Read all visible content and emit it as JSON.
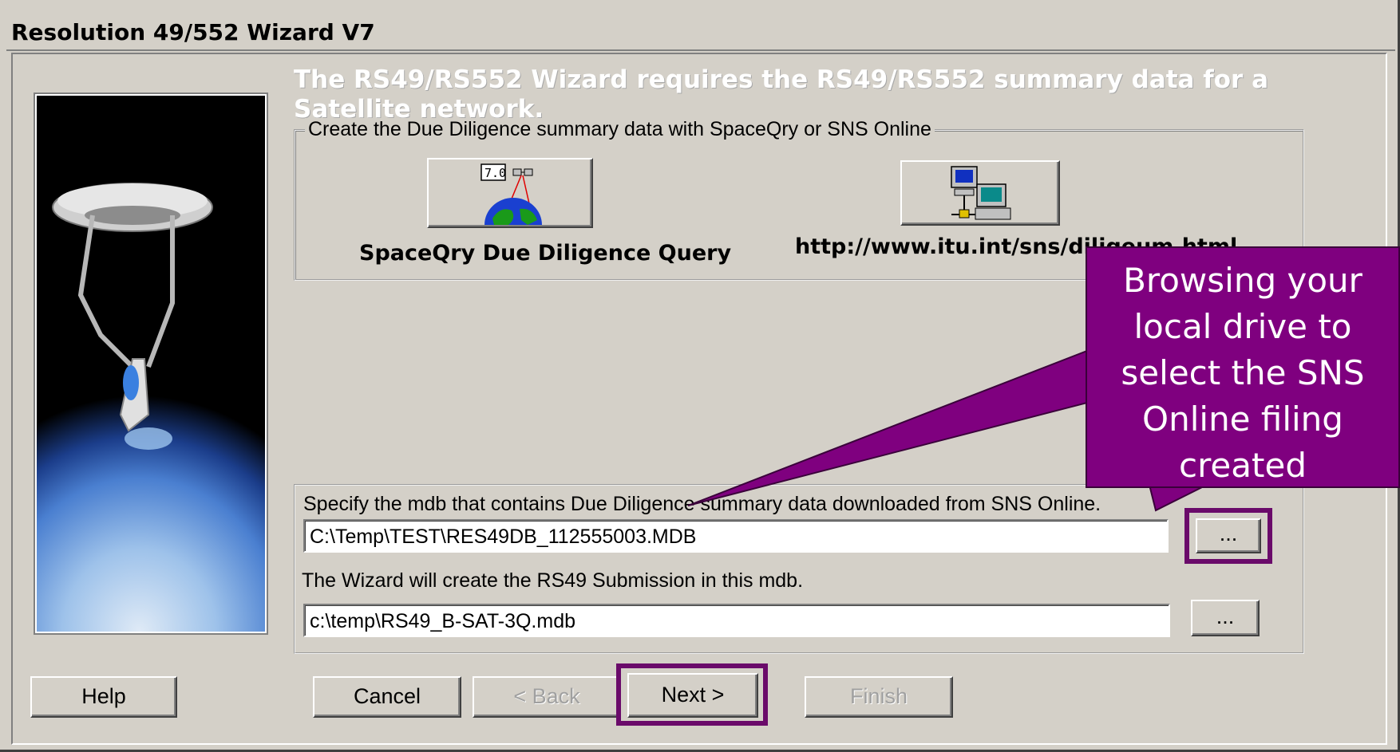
{
  "window": {
    "title": "Resolution 49/552 Wizard V7"
  },
  "intro_text": "The RS49/RS552 Wizard requires the RS49/RS552 summary data for a Satellite network.",
  "create_group": {
    "label": "Create the Due Diligence summary data with SpaceQry or SNS Online",
    "spaceqry_caption": "SpaceQry Due Diligence Query",
    "spaceqry_icon_badge": "7.0",
    "sns_caption": "http://www.itu.int/sns/diligeum.html"
  },
  "source_mdb": {
    "label": "Specify the mdb that contains  Due Diligence summary data downloaded from SNS Online.",
    "value": "C:\\Temp\\TEST\\RES49DB_112555003.MDB",
    "browse_label": "..."
  },
  "target_mdb": {
    "label": "The Wizard will create the  RS49 Submission in this mdb.",
    "value": "c:\\temp\\RS49_B-SAT-3Q.mdb",
    "browse_label": "..."
  },
  "buttons": {
    "help": "Help",
    "cancel": "Cancel",
    "back": "< Back",
    "next": "Next >",
    "finish": "Finish"
  },
  "callout": {
    "text": "Browsing your local drive to select the SNS Online filing created",
    "color": "#7f007f"
  },
  "icons": {
    "spaceqry": "globe-satellite-icon",
    "sns": "networked-computers-icon"
  }
}
